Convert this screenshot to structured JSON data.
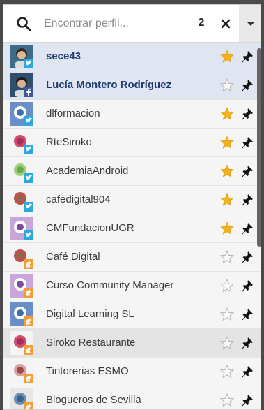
{
  "search": {
    "placeholder": "Encontrar perfil...",
    "count": "2"
  },
  "icons": {
    "search": "search-icon",
    "close": "close-icon",
    "menu": "chevron-down-icon",
    "star": "star-icon",
    "pin": "pin-icon",
    "twitter": "twitter-icon",
    "facebook": "facebook-icon",
    "foursquare": "foursquare-icon"
  },
  "colors": {
    "star_on": "#f2b21e",
    "star_off": "#b8b8b8",
    "selected_row": "#dfe6f1",
    "twitter": "#2aa9e0",
    "facebook": "#3b5998",
    "foursquare": "#f39c38"
  },
  "profiles": [
    {
      "name": "sece43",
      "network": "twitter",
      "starred": true,
      "selected": true,
      "bold": true
    },
    {
      "name": "Lucía Montero Rodríguez",
      "network": "facebook",
      "starred": false,
      "selected": true,
      "bold": true
    },
    {
      "name": "dlformacion",
      "network": "twitter",
      "starred": true
    },
    {
      "name": "RteSiroko",
      "network": "twitter",
      "starred": true
    },
    {
      "name": "AcademiaAndroid",
      "network": "twitter",
      "starred": true
    },
    {
      "name": "cafedigital904",
      "network": "twitter",
      "starred": true
    },
    {
      "name": "CMFundacionUGR",
      "network": "twitter",
      "starred": true
    },
    {
      "name": "Café Digital",
      "network": "foursquare",
      "starred": false
    },
    {
      "name": "Curso Community Manager",
      "network": "foursquare",
      "starred": false
    },
    {
      "name": "Digital Learning SL",
      "network": "foursquare",
      "starred": false
    },
    {
      "name": "Siroko Restaurante",
      "network": "foursquare",
      "starred": false,
      "hover": true
    },
    {
      "name": "Tintorerias ESMO",
      "network": "foursquare",
      "starred": false
    },
    {
      "name": "Blogueros de Sevilla",
      "network": "foursquare",
      "starred": false
    }
  ]
}
